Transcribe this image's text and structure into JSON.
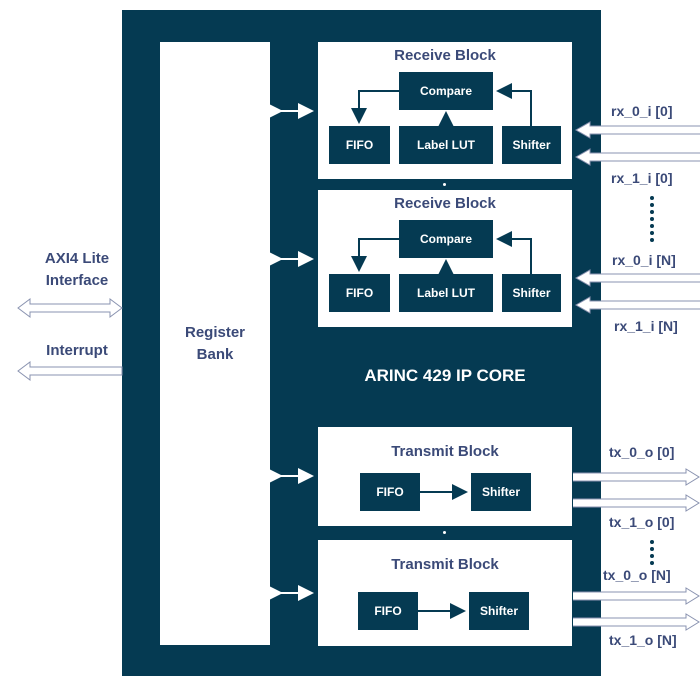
{
  "core": {
    "title": "ARINC 429 IP CORE"
  },
  "register_bank": {
    "label_line1": "Register",
    "label_line2": "Bank"
  },
  "receive_blocks": [
    {
      "title": "Receive Block",
      "compare": "Compare",
      "fifo": "FIFO",
      "label_lut": "Label LUT",
      "shifter": "Shifter"
    },
    {
      "title": "Receive Block",
      "compare": "Compare",
      "fifo": "FIFO",
      "label_lut": "Label LUT",
      "shifter": "Shifter"
    }
  ],
  "transmit_blocks": [
    {
      "title": "Transmit Block",
      "fifo": "FIFO",
      "shifter": "Shifter"
    },
    {
      "title": "Transmit Block",
      "fifo": "FIFO",
      "shifter": "Shifter"
    }
  ],
  "external": {
    "axi_line1": "AXI4 Lite",
    "axi_line2": "Interface",
    "interrupt": "Interrupt"
  },
  "rx_signals": [
    "rx_0_i [0]",
    "rx_1_i [0]",
    "rx_0_i [N]",
    "rx_1_i [N]"
  ],
  "tx_signals": [
    "tx_0_o [0]",
    "tx_1_o [0]",
    "tx_0_o [N]",
    "tx_1_o [N]"
  ],
  "colors": {
    "core": "#053a52",
    "label_text": "#3b4a78",
    "arrow_outline": "#8a93b0"
  }
}
